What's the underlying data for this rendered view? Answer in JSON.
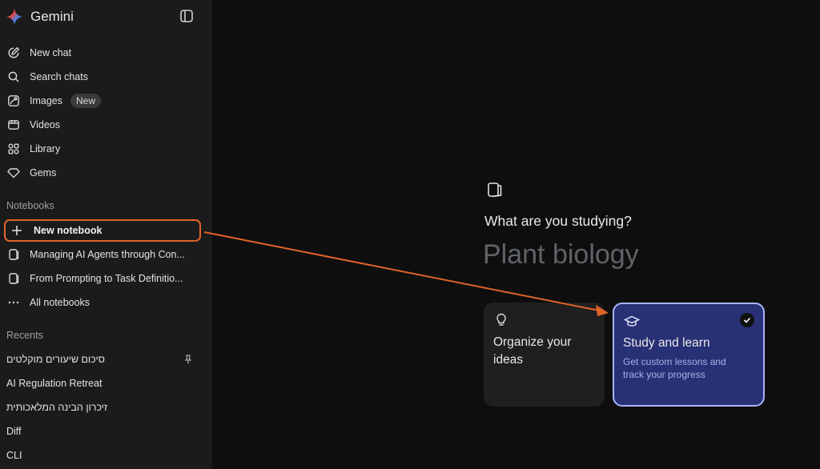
{
  "app": {
    "name": "Gemini"
  },
  "sidebar": {
    "nav": [
      {
        "label": "New chat",
        "icon": "edit-icon"
      },
      {
        "label": "Search chats",
        "icon": "search-icon"
      },
      {
        "label": "Images",
        "icon": "image-icon",
        "badge": "New"
      },
      {
        "label": "Videos",
        "icon": "video-icon"
      },
      {
        "label": "Library",
        "icon": "library-icon"
      },
      {
        "label": "Gems",
        "icon": "gem-icon"
      }
    ],
    "notebooks_label": "Notebooks",
    "notebooks": {
      "new_label": "New notebook",
      "items": [
        "Managing AI Agents through Con...",
        "From Prompting to Task Definitio..."
      ],
      "all_label": "All notebooks"
    },
    "recents_label": "Recents",
    "recents": [
      "סיכום שיעורים מוקלטים",
      "AI Regulation Retreat",
      "זיכרון הבינה המלאכותית",
      "Diff",
      "CLI"
    ]
  },
  "main": {
    "question": "What are you studying?",
    "input_placeholder": "Plant biology",
    "cards": [
      {
        "title": "Organize your ideas",
        "icon": "lightbulb-icon"
      },
      {
        "title": "Study and learn",
        "description": "Get custom lessons and track your progress",
        "icon": "graduation-cap-icon",
        "selected": true
      }
    ]
  },
  "colors": {
    "sidebar_bg": "#1b1b1b",
    "main_bg": "#0e0e0e",
    "highlight": "#e0632a",
    "selected_card_bg": "#283175",
    "selected_card_border": "#aab4ff"
  }
}
